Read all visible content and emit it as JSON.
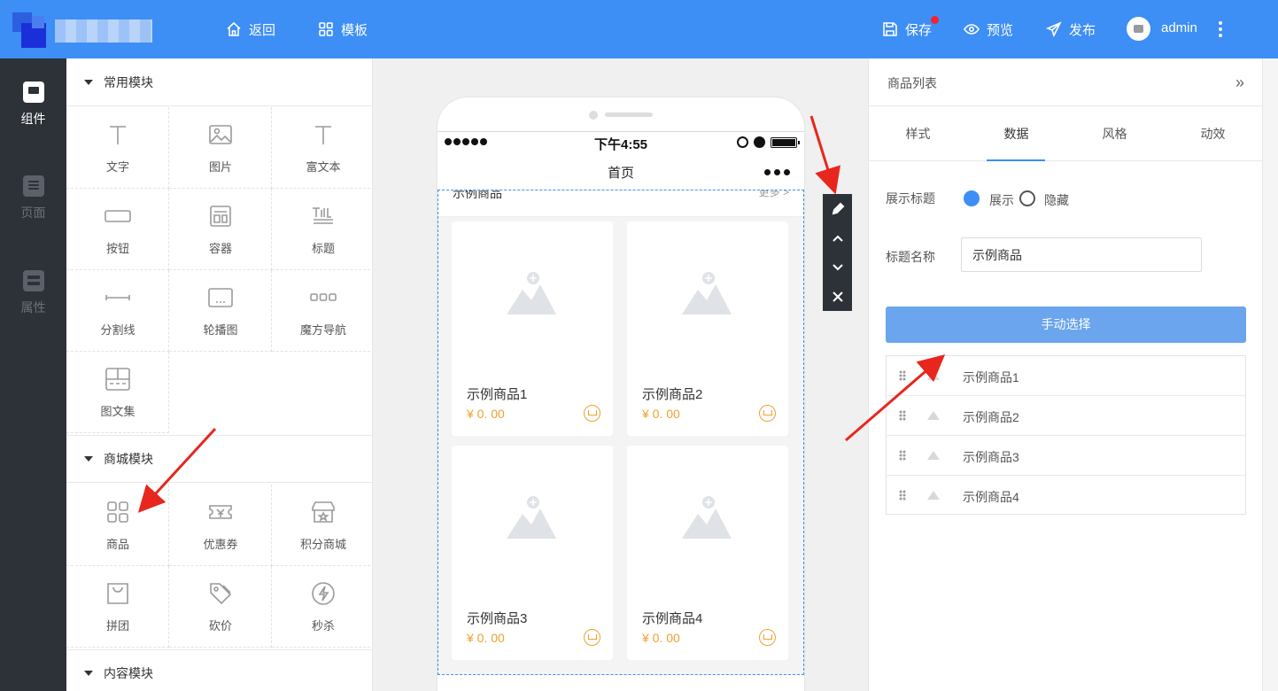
{
  "topbar": {
    "back": "返回",
    "templates": "模板",
    "save": "保存",
    "preview": "预览",
    "publish": "发布",
    "user": "admin"
  },
  "sidenav": [
    {
      "label": "组件",
      "icon": "component-icon"
    },
    {
      "label": "页面",
      "icon": "page-icon"
    },
    {
      "label": "属性",
      "icon": "property-icon"
    }
  ],
  "groups": {
    "common": "常用模块",
    "mall": "商城模块",
    "content": "内容模块"
  },
  "common_items": [
    "文字",
    "图片",
    "富文本",
    "按钮",
    "容器",
    "标题",
    "分割线",
    "轮播图",
    "魔方导航",
    "图文集"
  ],
  "mall_items": [
    "商品",
    "优惠券",
    "积分商城",
    "拼团",
    "砍价",
    "秒杀"
  ],
  "phone": {
    "time": "下午4:55",
    "title": "首页",
    "section_title": "示例商品",
    "section_more": "更多 >",
    "goods": [
      {
        "name": "示例商品1",
        "price": "¥ 0. 00"
      },
      {
        "name": "示例商品2",
        "price": "¥ 0. 00"
      },
      {
        "name": "示例商品3",
        "price": "¥ 0. 00"
      },
      {
        "name": "示例商品4",
        "price": "¥ 0. 00"
      }
    ]
  },
  "panel": {
    "title": "商品列表",
    "tabs": [
      "样式",
      "数据",
      "风格",
      "动效"
    ],
    "show_title_label": "展示标题",
    "show": "展示",
    "hide": "隐藏",
    "title_name_label": "标题名称",
    "title_name_value": "示例商品",
    "manual_select": "手动选择",
    "list": [
      "示例商品1",
      "示例商品2",
      "示例商品3",
      "示例商品4"
    ]
  },
  "colors": {
    "primary": "#3d8ef5",
    "sidebar": "#2d3138",
    "price": "#f0a030",
    "annotation": "#e8261d"
  }
}
